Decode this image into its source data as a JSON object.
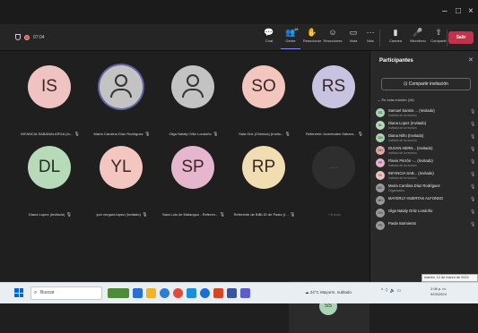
{
  "window": {
    "minimize": "–",
    "maximize": "□",
    "close": "×"
  },
  "toolbar": {
    "timer": "07:04",
    "buttons": [
      {
        "label": "Chat",
        "icon": "chat-icon",
        "glyph": "💬"
      },
      {
        "label": "Gente",
        "icon": "people-icon",
        "glyph": "👥",
        "badge": "16"
      },
      {
        "label": "Reaccionar",
        "icon": "hand-icon",
        "glyph": "✋"
      },
      {
        "label": "Reacciones",
        "icon": "reactions-icon",
        "glyph": "☺"
      },
      {
        "label": "Vista",
        "icon": "view-icon",
        "glyph": "▭"
      },
      {
        "label": "Más",
        "icon": "more-icon",
        "glyph": "···"
      },
      {
        "label": "Cámara",
        "icon": "camera-icon",
        "glyph": "▮"
      },
      {
        "label": "Micrófono",
        "icon": "microphone-icon",
        "glyph": "🎤"
      },
      {
        "label": "Compartir",
        "icon": "share-icon",
        "glyph": "⇧"
      }
    ],
    "leave_label": "Salir"
  },
  "tiles": [
    {
      "initials": "IS",
      "color": "#eec3c1",
      "name": "INFANCIA SABANALARGA (In...",
      "dark": false
    },
    {
      "initials": "",
      "color": "#c3c3c3",
      "name": "María Carolina Díaz Rodríguez",
      "person": true,
      "ring": true
    },
    {
      "initials": "",
      "color": "#c3c3c3",
      "name": "Olga Nataly Ortiz Londoño",
      "person": true
    },
    {
      "initials": "SO",
      "color": "#f2c6bd",
      "name": "Sala Oriz (Chimica) (Invita...",
      "dark": false
    },
    {
      "initials": "RS",
      "color": "#c8c3e0",
      "name": "Referente Juventudes Sabam...",
      "dark": false
    },
    {
      "initials": "DL",
      "color": "#b7dab9",
      "name": "Diana Lopez (Invitado)",
      "dark": true
    },
    {
      "initials": "YL",
      "color": "#f3c7c0",
      "name": "yuri vergara lopez (Invitado)",
      "dark": false
    },
    {
      "initials": "SP",
      "color": "#e6b6ce",
      "name": "Sara Luis de Malanguo - Referen...",
      "dark": false
    },
    {
      "initials": "RP",
      "color": "#f1ddb2",
      "name": "Referente de BIBLIO de Pasto (I...",
      "dark": false
    },
    {
      "initials": "···",
      "color": "#2e2e2e",
      "name": "+6 más",
      "blank": true
    }
  ],
  "self_view": {
    "initials": "SS"
  },
  "panel": {
    "title": "Participantes",
    "share_label": "Compartir invitación",
    "section_label": "En esta reunión (16)",
    "people": [
      {
        "initials": "SS",
        "color": "#a9d5b4",
        "name": "Samuel Santos ... (Invitado)",
        "sub": "Invitado de la reunión"
      },
      {
        "initials": "DL",
        "color": "#b7dab9",
        "name": "Diana Lopez (Invitado)",
        "sub": "Invitado de la reunión"
      },
      {
        "initials": "DN",
        "color": "#a9d5b4",
        "name": "Diana Niño (Invitado)",
        "sub": "Invitado de la reunión"
      },
      {
        "initials": "DH",
        "color": "#e6a7a7",
        "name": "DUVAN HERN... (Invitado)",
        "sub": "Invitado de la reunión"
      },
      {
        "initials": "FP",
        "color": "#e6b6ce",
        "name": "Flavio Pinzón -... (Invitado)",
        "sub": "Invitado de la reunión"
      },
      {
        "initials": "IS",
        "color": "#eec3c1",
        "name": "INFANCIA SAB... (Invitado)",
        "sub": "Invitado de la reunión"
      },
      {
        "initials": "MC",
        "color": "#9a9a9a",
        "name": "María Carolina Díaz Rodríguez",
        "sub": "Organizador"
      },
      {
        "initials": "MH",
        "color": "#9a9a9a",
        "name": "MAYERLY HUERTAS ALFONSO",
        "sub": ""
      },
      {
        "initials": "ON",
        "color": "#9a9a9a",
        "name": "Olga Nataly Ortiz Londoño",
        "sub": ""
      },
      {
        "initials": "PS",
        "color": "#9a9a9a",
        "name": "Paula Sarmiento",
        "sub": ""
      }
    ]
  },
  "taskbar": {
    "search_placeholder": "Buscar",
    "weather": "24°C  Mayorm. nublado",
    "clock_time": "2:08 p. m.",
    "clock_date": "9/03/2024",
    "tooltip": "martes, 12 de marzo de 2024"
  }
}
